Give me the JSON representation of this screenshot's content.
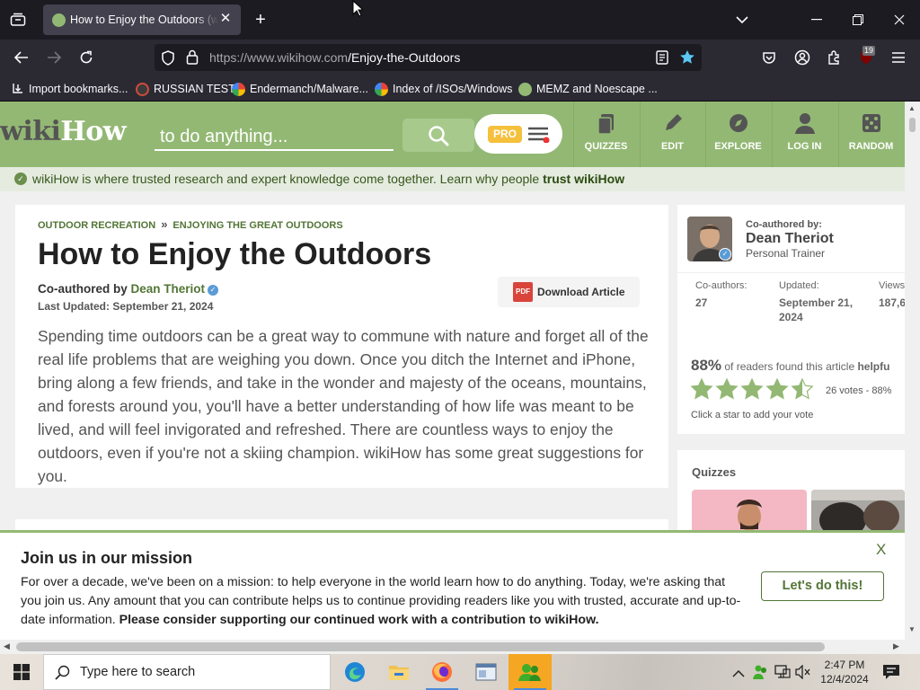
{
  "browser": {
    "tab_title": "How to Enjoy the Outdoors (wikiHow)",
    "url_host": "https://www.wikihow.com",
    "url_path": "/Enjoy-the-Outdoors",
    "notification_count": "19",
    "bookmarks": [
      {
        "label": "Import bookmarks...",
        "icon": "import-icon"
      },
      {
        "label": "RUSSIAN TEST",
        "icon": "site-icon"
      },
      {
        "label": "Endermanch/Malware...",
        "icon": "google-icon"
      },
      {
        "label": "Index of /ISOs/Windows",
        "icon": "google-icon"
      },
      {
        "label": "MEMZ and Noescape ...",
        "icon": "site-icon"
      }
    ]
  },
  "wikihow": {
    "logo_wiki": "wiki",
    "logo_how": "How",
    "search_placeholder": "to do anything...",
    "pro_label": "PRO",
    "nav": [
      {
        "label": "QUIZZES",
        "icon": "quiz-icon"
      },
      {
        "label": "EDIT",
        "icon": "pencil-icon"
      },
      {
        "label": "EXPLORE",
        "icon": "compass-icon"
      },
      {
        "label": "LOG IN",
        "icon": "user-icon"
      },
      {
        "label": "RANDOM",
        "icon": "dice-icon"
      }
    ],
    "trust_text": "wikiHow is where trusted research and expert knowledge come together. Learn why people ",
    "trust_link": "trust wikiHow",
    "accent": "#93b874"
  },
  "article": {
    "breadcrumb": [
      "OUTDOOR RECREATION",
      "ENJOYING THE GREAT OUTDOORS"
    ],
    "breadcrumb_sep": "»",
    "title": "How to Enjoy the Outdoors",
    "coauthored_label": "Co-authored by",
    "author": "Dean Theriot",
    "updated": "Last Updated: September 21, 2024",
    "download_label": "Download Article",
    "pdf_label": "PDF",
    "intro": "Spending time outdoors can be a great way to commune with nature and forget all of the real life problems that are weighing you down. Once you ditch the Internet and iPhone, bring along a few friends, and take in the wonder and majesty of the oceans, mountains, and forests around you, you'll have a better understanding of how life was meant to be lived, and will feel invigorated and refreshed. There are countless ways to enjoy the outdoors, even if you're not a skiing champion. wikiHow has some great suggestions for you."
  },
  "sidebar": {
    "coauthored_by": "Co-authored by:",
    "author_name": "Dean Theriot",
    "author_role": "Personal Trainer",
    "stats": [
      {
        "label": "Co-authors:",
        "value": "27"
      },
      {
        "label": "Updated:",
        "value": "September 21, 2024"
      },
      {
        "label": "Views:",
        "value": "187,6"
      }
    ],
    "helpful_pct": "88%",
    "helpful_text": "of readers found this article ",
    "helpful_bold": "helpfu",
    "rating": 4.5,
    "votes_text": "26 votes - 88%",
    "click_text": "Click a star to add your vote",
    "quizzes_title": "Quizzes"
  },
  "banner": {
    "title": "Join us in our mission",
    "text": "For over a decade, we've been on a mission: to help everyone in the world learn how to do anything. Today, we're asking that you join us. Any amount that you can contribute helps us to continue providing readers like you with trusted, accurate and up-to-date information. ",
    "text_bold": "Please consider supporting our continued work with a contribution to wikiHow.",
    "cta": "Let's do this!",
    "close": "X"
  },
  "taskbar": {
    "search_placeholder": "Type here to search",
    "time": "2:47 PM",
    "date": "12/4/2024"
  }
}
